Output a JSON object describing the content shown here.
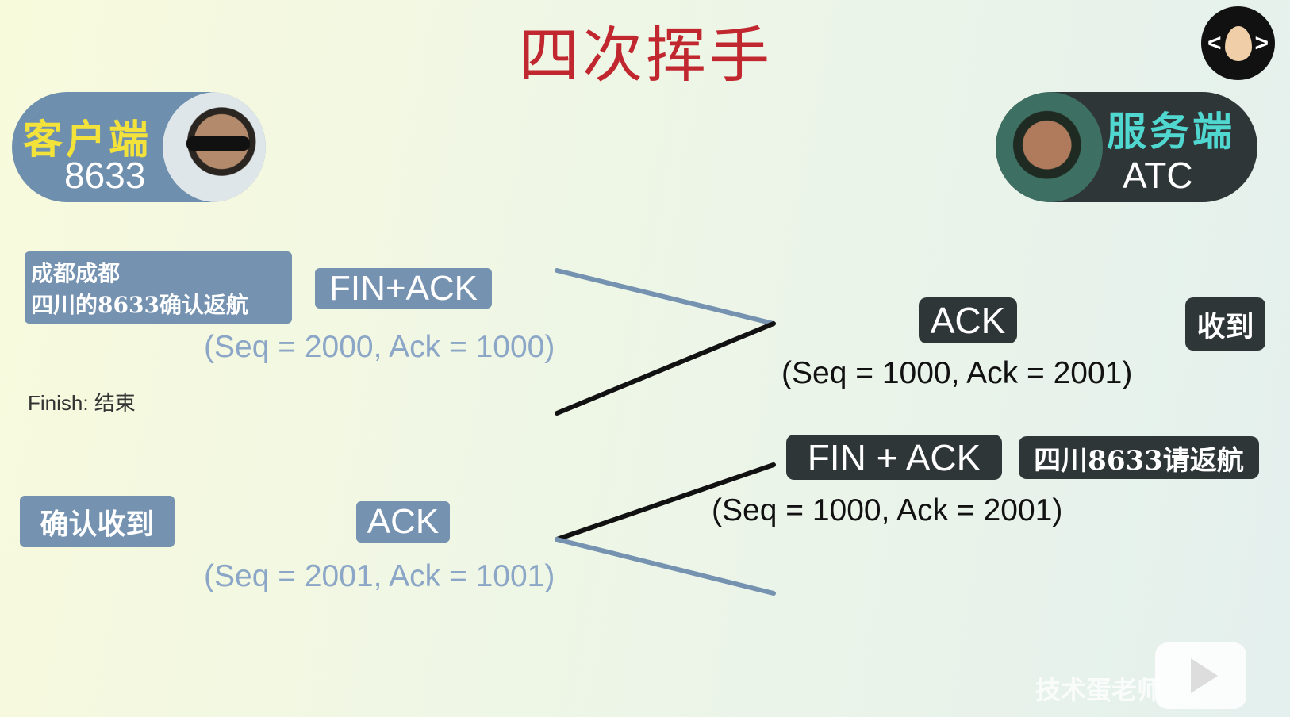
{
  "title": "四次挥手",
  "logo": {
    "icon": "egg-code-logo",
    "left": "<",
    "right": ">"
  },
  "client": {
    "label": "客户端",
    "id": "8633",
    "label_color": "#f2e23a"
  },
  "server": {
    "label": "服务端",
    "id": "ATC",
    "label_color": "#4fd7d0"
  },
  "step1": {
    "note_line1": "成都成都",
    "note_line2": "四川的8633确认返航",
    "flag": "FIN+ACK",
    "seq": "(Seq = 2000, Ack = 1000)"
  },
  "finish_note": "Finish: 结束",
  "step2": {
    "flag": "ACK",
    "note": "收到",
    "seq": "(Seq = 1000, Ack = 2001)"
  },
  "step3": {
    "flag": "FIN + ACK",
    "note": "四川8633请返航",
    "seq": "(Seq = 1000, Ack = 2001)"
  },
  "step4": {
    "note": "确认收到",
    "flag": "ACK",
    "seq": "(Seq = 2001, Ack = 1001)"
  },
  "watermark": "技术蛋老师",
  "colors": {
    "title": "#c1272f",
    "client_box": "#7592b0",
    "server_box": "#2f3638",
    "light_text": "#8ba6c6"
  }
}
